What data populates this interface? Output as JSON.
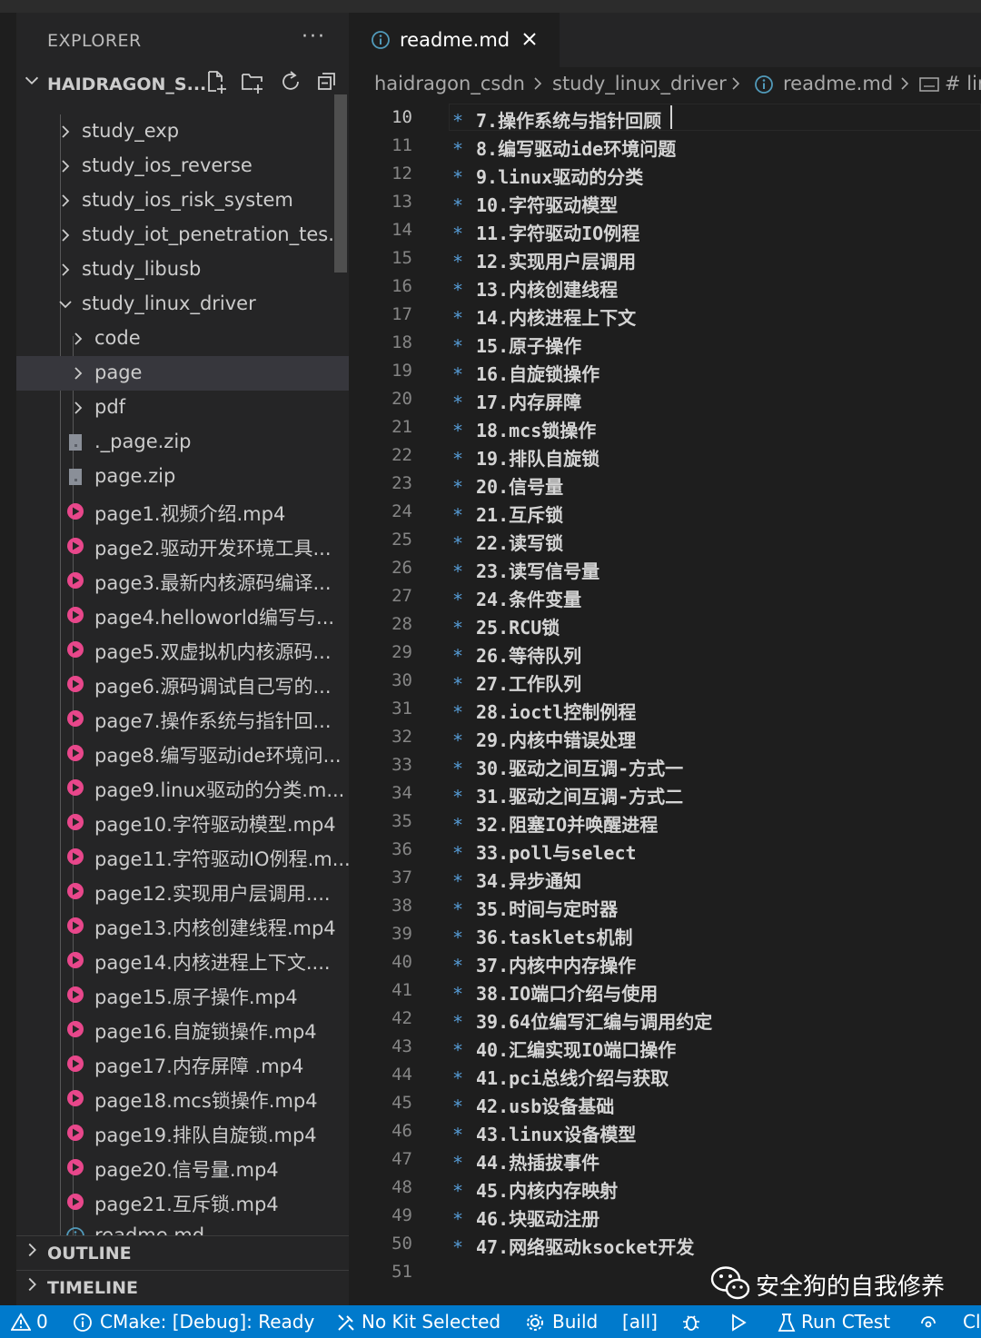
{
  "explorer": {
    "title": "EXPLORER",
    "more": "···",
    "workspace": "HAIDRAGON_S...",
    "outline": "OUTLINE",
    "timeline": "TIMELINE"
  },
  "tree": [
    {
      "label": "study_exp",
      "type": "folder",
      "expanded": false,
      "depth": 1
    },
    {
      "label": "study_ios_reverse",
      "type": "folder",
      "expanded": false,
      "depth": 1
    },
    {
      "label": "study_ios_risk_system",
      "type": "folder",
      "expanded": false,
      "depth": 1
    },
    {
      "label": "study_iot_penetration_tes...",
      "type": "folder",
      "expanded": false,
      "depth": 1
    },
    {
      "label": "study_libusb",
      "type": "folder",
      "expanded": false,
      "depth": 1
    },
    {
      "label": "study_linux_driver",
      "type": "folder",
      "expanded": true,
      "depth": 1
    },
    {
      "label": "code",
      "type": "folder",
      "expanded": false,
      "depth": 2
    },
    {
      "label": "page",
      "type": "folder",
      "expanded": false,
      "depth": 2,
      "selected": true
    },
    {
      "label": "pdf",
      "type": "folder",
      "expanded": false,
      "depth": 2
    },
    {
      "label": "._page.zip",
      "type": "zip",
      "depth": 2
    },
    {
      "label": "page.zip",
      "type": "zip",
      "depth": 2
    },
    {
      "label": "page1.视频介绍.mp4",
      "type": "video",
      "depth": 2
    },
    {
      "label": "page2.驱动开发环境工具...",
      "type": "video",
      "depth": 2
    },
    {
      "label": "page3.最新内核源码编译...",
      "type": "video",
      "depth": 2
    },
    {
      "label": "page4.helloworld编写与...",
      "type": "video",
      "depth": 2
    },
    {
      "label": "page5.双虚拟机内核源码...",
      "type": "video",
      "depth": 2
    },
    {
      "label": "page6.源码调试自己写的...",
      "type": "video",
      "depth": 2
    },
    {
      "label": "page7.操作系统与指针回...",
      "type": "video",
      "depth": 2
    },
    {
      "label": "page8.编写驱动ide环境问...",
      "type": "video",
      "depth": 2
    },
    {
      "label": "page9.linux驱动的分类.m...",
      "type": "video",
      "depth": 2
    },
    {
      "label": "page10.字符驱动模型.mp4",
      "type": "video",
      "depth": 2
    },
    {
      "label": "page11.字符驱动IO例程.m...",
      "type": "video",
      "depth": 2
    },
    {
      "label": "page12.实现用户层调用....",
      "type": "video",
      "depth": 2
    },
    {
      "label": "page13.内核创建线程.mp4",
      "type": "video",
      "depth": 2
    },
    {
      "label": "page14.内核进程上下文....",
      "type": "video",
      "depth": 2
    },
    {
      "label": "page15.原子操作.mp4",
      "type": "video",
      "depth": 2
    },
    {
      "label": "page16.自旋锁操作.mp4",
      "type": "video",
      "depth": 2
    },
    {
      "label": "page17.内存屏障 .mp4",
      "type": "video",
      "depth": 2
    },
    {
      "label": "page18.mcs锁操作.mp4",
      "type": "video",
      "depth": 2
    },
    {
      "label": "page19.排队自旋锁.mp4",
      "type": "video",
      "depth": 2
    },
    {
      "label": "page20.信号量.mp4",
      "type": "video",
      "depth": 2
    },
    {
      "label": "page21.互斥锁.mp4",
      "type": "video",
      "depth": 2
    },
    {
      "label": "readme.md",
      "type": "info",
      "depth": 2,
      "selected": true
    }
  ],
  "tab": {
    "name": "readme.md",
    "close": "×"
  },
  "breadcrumb": [
    "haidragon_csdn",
    "study_linux_driver",
    "readme.md",
    "# lin"
  ],
  "editor": {
    "current_line": 10,
    "lines": [
      {
        "n": "10",
        "text": "7.操作系统与指针回顾"
      },
      {
        "n": "11",
        "text": "8.编写驱动ide环境问题"
      },
      {
        "n": "12",
        "text": "9.linux驱动的分类"
      },
      {
        "n": "13",
        "text": "10.字符驱动模型"
      },
      {
        "n": "14",
        "text": "11.字符驱动IO例程"
      },
      {
        "n": "15",
        "text": "12.实现用户层调用"
      },
      {
        "n": "16",
        "text": "13.内核创建线程"
      },
      {
        "n": "17",
        "text": "14.内核进程上下文"
      },
      {
        "n": "18",
        "text": "15.原子操作"
      },
      {
        "n": "19",
        "text": "16.自旋锁操作"
      },
      {
        "n": "20",
        "text": "17.内存屏障"
      },
      {
        "n": "21",
        "text": "18.mcs锁操作"
      },
      {
        "n": "22",
        "text": "19.排队自旋锁"
      },
      {
        "n": "23",
        "text": "20.信号量"
      },
      {
        "n": "24",
        "text": "21.互斥锁"
      },
      {
        "n": "25",
        "text": "22.读写锁"
      },
      {
        "n": "26",
        "text": "23.读写信号量"
      },
      {
        "n": "27",
        "text": "24.条件变量"
      },
      {
        "n": "28",
        "text": "25.RCU锁"
      },
      {
        "n": "29",
        "text": "26.等待队列"
      },
      {
        "n": "30",
        "text": "27.工作队列"
      },
      {
        "n": "31",
        "text": "28.ioctl控制例程"
      },
      {
        "n": "32",
        "text": "29.内核中错误处理"
      },
      {
        "n": "33",
        "text": "30.驱动之间互调-方式一"
      },
      {
        "n": "34",
        "text": "31.驱动之间互调-方式二"
      },
      {
        "n": "35",
        "text": "32.阻塞IO并唤醒进程"
      },
      {
        "n": "36",
        "text": "33.poll与select"
      },
      {
        "n": "37",
        "text": "34.异步通知"
      },
      {
        "n": "38",
        "text": "35.时间与定时器"
      },
      {
        "n": "39",
        "text": "36.tasklets机制"
      },
      {
        "n": "40",
        "text": "37.内核中内存操作"
      },
      {
        "n": "41",
        "text": "38.IO端口介绍与使用"
      },
      {
        "n": "42",
        "text": "39.64位编写汇编与调用约定"
      },
      {
        "n": "43",
        "text": "40.汇编实现IO端口操作"
      },
      {
        "n": "44",
        "text": "41.pci总线介绍与获取"
      },
      {
        "n": "45",
        "text": "42.usb设备基础"
      },
      {
        "n": "46",
        "text": "43.linux设备模型"
      },
      {
        "n": "47",
        "text": "44.热插拔事件"
      },
      {
        "n": "48",
        "text": "45.内核内存映射"
      },
      {
        "n": "49",
        "text": "46.块驱动注册"
      },
      {
        "n": "50",
        "text": "47.网络驱动ksocket开发"
      },
      {
        "n": "51",
        "text": ""
      }
    ],
    "bullet": "∗"
  },
  "watermark": "安全狗的自我修养",
  "statusbar": {
    "warnings": "0",
    "cmake": "CMake: [Debug]: Ready",
    "kit": "No Kit Selected",
    "build": "Build",
    "target": "[all]",
    "run_ctest": "Run CTest",
    "last": "Cl"
  },
  "colors": {
    "accent": "#007acc",
    "sidebar_bg": "#252526",
    "editor_bg": "#1e1e1e",
    "video_icon": "#e8478b",
    "keyword_star": "#569cd6"
  }
}
